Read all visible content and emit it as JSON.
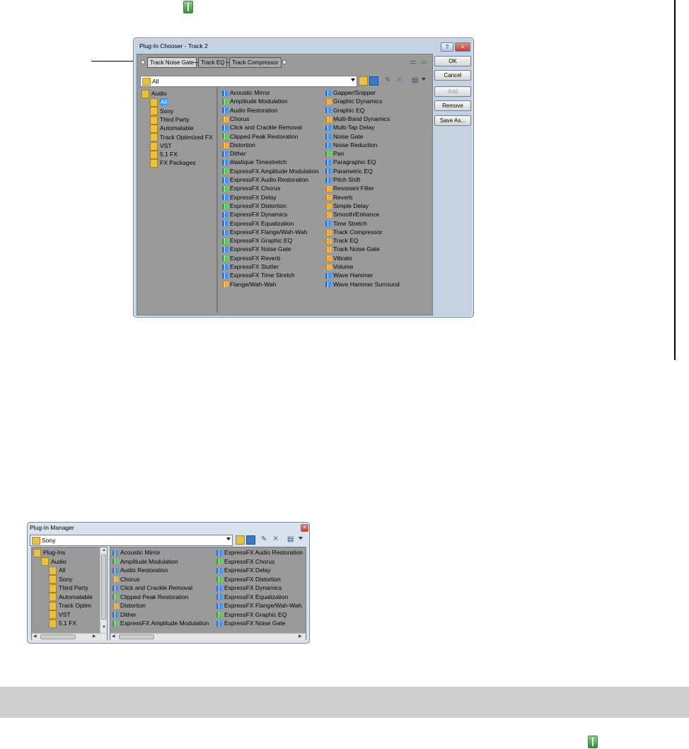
{
  "chooser": {
    "title": "Plug-In Chooser - Track 2",
    "help_glyph": "?",
    "close_glyph": "×",
    "chain": [
      "Track Noise Gate",
      "Track EQ",
      "Track Compressor"
    ],
    "path": "All",
    "tree": [
      {
        "label": "Audio",
        "level": 0,
        "selected": false
      },
      {
        "label": "All",
        "level": 1,
        "selected": true
      },
      {
        "label": "Sony",
        "level": 1,
        "selected": false
      },
      {
        "label": "Third Party",
        "level": 1,
        "selected": false
      },
      {
        "label": "Automatable",
        "level": 1,
        "selected": false
      },
      {
        "label": "Track Optimized FX",
        "level": 1,
        "selected": false
      },
      {
        "label": "VST",
        "level": 1,
        "selected": false
      },
      {
        "label": "5.1 FX",
        "level": 1,
        "selected": false
      },
      {
        "label": "FX Packages",
        "level": 1,
        "selected": false
      }
    ],
    "col1": [
      {
        "label": "Acoustic Mirror",
        "icon": "b"
      },
      {
        "label": "Amplitude Modulation",
        "icon": "g"
      },
      {
        "label": "Audio Restoration",
        "icon": "b"
      },
      {
        "label": "Chorus",
        "icon": "o"
      },
      {
        "label": "Click and Crackle Removal",
        "icon": "b"
      },
      {
        "label": "Clipped Peak Restoration",
        "icon": "g"
      },
      {
        "label": "Distortion",
        "icon": "o"
      },
      {
        "label": "Dither",
        "icon": "b"
      },
      {
        "label": "élastique Timestretch",
        "icon": "b"
      },
      {
        "label": "ExpressFX Amplitude Modulation",
        "icon": "g"
      },
      {
        "label": "ExpressFX Audio Restoration",
        "icon": "b"
      },
      {
        "label": "ExpressFX Chorus",
        "icon": "g"
      },
      {
        "label": "ExpressFX Delay",
        "icon": "b"
      },
      {
        "label": "ExpressFX Distortion",
        "icon": "g"
      },
      {
        "label": "ExpressFX Dynamics",
        "icon": "b"
      },
      {
        "label": "ExpressFX Equalization",
        "icon": "b"
      },
      {
        "label": "ExpressFX Flange/Wah-Wah",
        "icon": "b"
      },
      {
        "label": "ExpressFX Graphic EQ",
        "icon": "g"
      },
      {
        "label": "ExpressFX Noise Gate",
        "icon": "b"
      },
      {
        "label": "ExpressFX Reverb",
        "icon": "g"
      },
      {
        "label": "ExpressFX Stutter",
        "icon": "b"
      },
      {
        "label": "ExpressFX Time Stretch",
        "icon": "b"
      },
      {
        "label": "Flange/Wah-Wah",
        "icon": "o"
      }
    ],
    "col2": [
      {
        "label": "Gapper/Snipper",
        "icon": "b"
      },
      {
        "label": "Graphic Dynamics",
        "icon": "o"
      },
      {
        "label": "Graphic EQ",
        "icon": "b"
      },
      {
        "label": "Multi-Band Dynamics",
        "icon": "o"
      },
      {
        "label": "Multi-Tap Delay",
        "icon": "b"
      },
      {
        "label": "Noise Gate",
        "icon": "b"
      },
      {
        "label": "Noise Reduction",
        "icon": "b"
      },
      {
        "label": "Pan",
        "icon": "g"
      },
      {
        "label": "Paragraphic EQ",
        "icon": "b"
      },
      {
        "label": "Parametric EQ",
        "icon": "b"
      },
      {
        "label": "Pitch Shift",
        "icon": "b"
      },
      {
        "label": "Resonant Filter",
        "icon": "o"
      },
      {
        "label": "Reverb",
        "icon": "o"
      },
      {
        "label": "Simple Delay",
        "icon": "o"
      },
      {
        "label": "Smooth/Enhance",
        "icon": "o"
      },
      {
        "label": "Time Stretch",
        "icon": "b"
      },
      {
        "label": "Track Compressor",
        "icon": "o"
      },
      {
        "label": "Track EQ",
        "icon": "o"
      },
      {
        "label": "Track Noise Gate",
        "icon": "o"
      },
      {
        "label": "Vibrato",
        "icon": "o"
      },
      {
        "label": "Volume",
        "icon": "o"
      },
      {
        "label": "Wave Hammer",
        "icon": "b"
      },
      {
        "label": "Wave Hammer Surround",
        "icon": "b"
      }
    ],
    "buttons": {
      "ok": "OK",
      "cancel": "Cancel",
      "add": "Add",
      "remove": "Remove",
      "save_as": "Save As..."
    }
  },
  "manager": {
    "title": "Plug-In Manager",
    "close_glyph": "×",
    "path": "Sony",
    "tree": [
      {
        "label": "Plug-Ins",
        "level": 0
      },
      {
        "label": "Audio",
        "level": 1
      },
      {
        "label": "All",
        "level": 2
      },
      {
        "label": "Sony",
        "level": 2
      },
      {
        "label": "Third Party",
        "level": 2
      },
      {
        "label": "Automatable",
        "level": 2
      },
      {
        "label": "Track Optim",
        "level": 2
      },
      {
        "label": "VST",
        "level": 2
      },
      {
        "label": "5.1 FX",
        "level": 2
      }
    ],
    "col1": [
      {
        "label": "Acoustic Mirror",
        "icon": "b"
      },
      {
        "label": "Amplitude Modulation",
        "icon": "g"
      },
      {
        "label": "Audio Restoration",
        "icon": "b"
      },
      {
        "label": "Chorus",
        "icon": "o"
      },
      {
        "label": "Click and Crackle Removal",
        "icon": "b"
      },
      {
        "label": "Clipped Peak Restoration",
        "icon": "g"
      },
      {
        "label": "Distortion",
        "icon": "o"
      },
      {
        "label": "Dither",
        "icon": "b"
      },
      {
        "label": "ExpressFX Amplitude Modulation",
        "icon": "g"
      }
    ],
    "col2": [
      {
        "label": "ExpressFX Audio Restoration",
        "icon": "b"
      },
      {
        "label": "ExpressFX Chorus",
        "icon": "g"
      },
      {
        "label": "ExpressFX Delay",
        "icon": "b"
      },
      {
        "label": "ExpressFX Distortion",
        "icon": "g"
      },
      {
        "label": "ExpressFX Dynamics",
        "icon": "b"
      },
      {
        "label": "ExpressFX Equalization",
        "icon": "b"
      },
      {
        "label": "ExpressFX Flange/Wah-Wah",
        "icon": "b"
      },
      {
        "label": "ExpressFX Graphic EQ",
        "icon": "g"
      },
      {
        "label": "ExpressFX Noise Gate",
        "icon": "b"
      }
    ]
  }
}
